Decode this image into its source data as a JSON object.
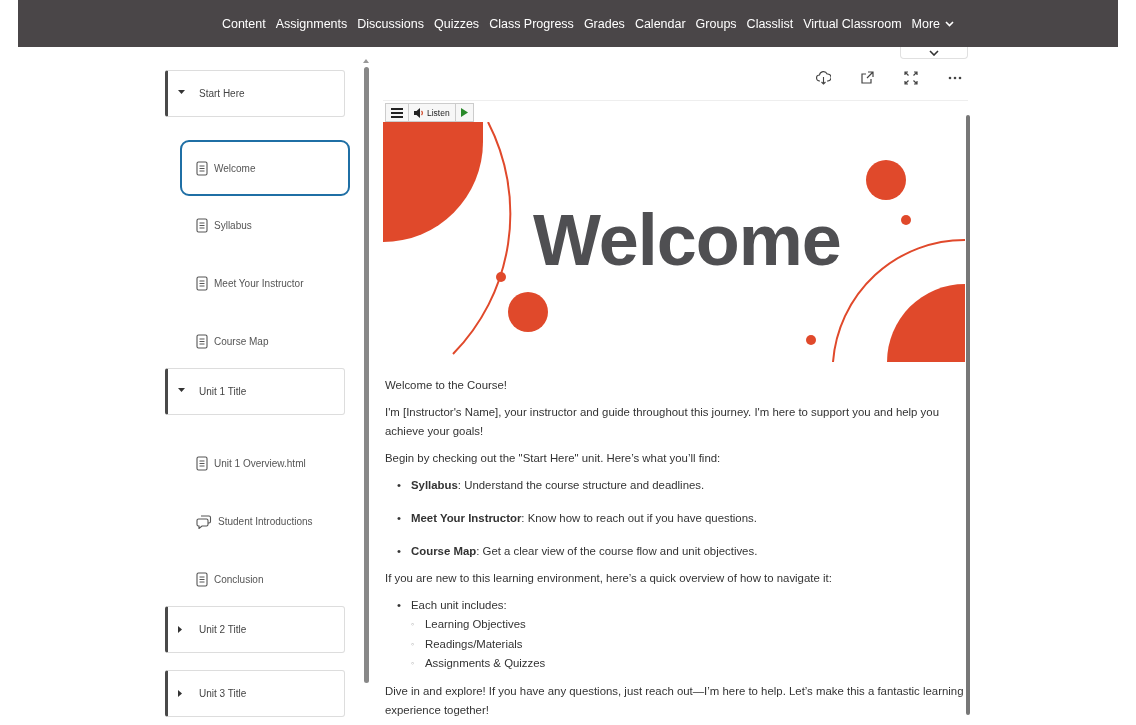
{
  "nav": {
    "items": [
      {
        "label": "Content"
      },
      {
        "label": "Assignments"
      },
      {
        "label": "Discussions"
      },
      {
        "label": "Quizzes"
      },
      {
        "label": "Class Progress"
      },
      {
        "label": "Grades"
      },
      {
        "label": "Calendar"
      },
      {
        "label": "Groups"
      },
      {
        "label": "Classlist"
      },
      {
        "label": "Virtual Classroom"
      },
      {
        "label": "More",
        "kind": "menu"
      }
    ]
  },
  "sidebar": {
    "units": [
      {
        "title": "Start Here",
        "expanded": true,
        "items": [
          {
            "label": "Welcome",
            "kind": "page",
            "selected": true
          },
          {
            "label": "Syllabus",
            "kind": "page",
            "selected": false
          },
          {
            "label": "Meet Your Instructor",
            "kind": "page",
            "selected": false
          },
          {
            "label": "Course Map",
            "kind": "page",
            "selected": false
          }
        ]
      },
      {
        "title": "Unit 1 Title",
        "expanded": true,
        "items": [
          {
            "label": "Unit 1 Overview.html",
            "kind": "page",
            "selected": false
          },
          {
            "label": "Student Introductions",
            "kind": "discussion",
            "selected": false
          },
          {
            "label": "Conclusion",
            "kind": "page",
            "selected": false
          }
        ]
      },
      {
        "title": "Unit 2 Title",
        "expanded": false
      },
      {
        "title": "Unit 3 Title",
        "expanded": false
      }
    ]
  },
  "toolbar": {
    "actions": [
      {
        "kind": "download"
      },
      {
        "kind": "popout"
      },
      {
        "kind": "fullscreen"
      },
      {
        "kind": "more"
      }
    ]
  },
  "reader": {
    "listen": "Listen"
  },
  "banner": {
    "title": "Welcome"
  },
  "article": {
    "blocks": [
      {
        "kind": "p",
        "text": "Welcome to the Course!"
      },
      {
        "kind": "p",
        "text": "I'm [Instructor's Name], your instructor and guide throughout this journey. I'm here to support you and help you achieve your goals!"
      },
      {
        "kind": "p",
        "text": "Begin by checking out the \"Start Here\" unit. Here’s what you’ll find:"
      },
      {
        "kind": "list",
        "items": [
          {
            "marker": "•",
            "text": "**Syllabus**: Understand the course structure and deadlines."
          },
          {
            "marker": "•",
            "text": "**Meet Your Instructor**: Know how to reach out if you have questions."
          },
          {
            "marker": "•",
            "text": "**Course Map**: Get a clear view of the course flow and unit objectives."
          }
        ]
      },
      {
        "kind": "p",
        "text": "If you are new to this learning environment, here’s a quick overview of how to navigate it:"
      },
      {
        "kind": "list",
        "items": [
          {
            "marker": "•",
            "text": "Each unit includes:",
            "children": [
              {
                "marker": "◦",
                "text": "Learning Objectives"
              },
              {
                "marker": "◦",
                "text": "Readings/Materials"
              },
              {
                "marker": "◦",
                "text": "Assignments & Quizzes"
              }
            ]
          }
        ]
      },
      {
        "kind": "p",
        "text": "Dive in and explore! If you have any questions, just reach out—I’m here to help. Let’s make this a fantastic learning experience together!"
      }
    ]
  }
}
